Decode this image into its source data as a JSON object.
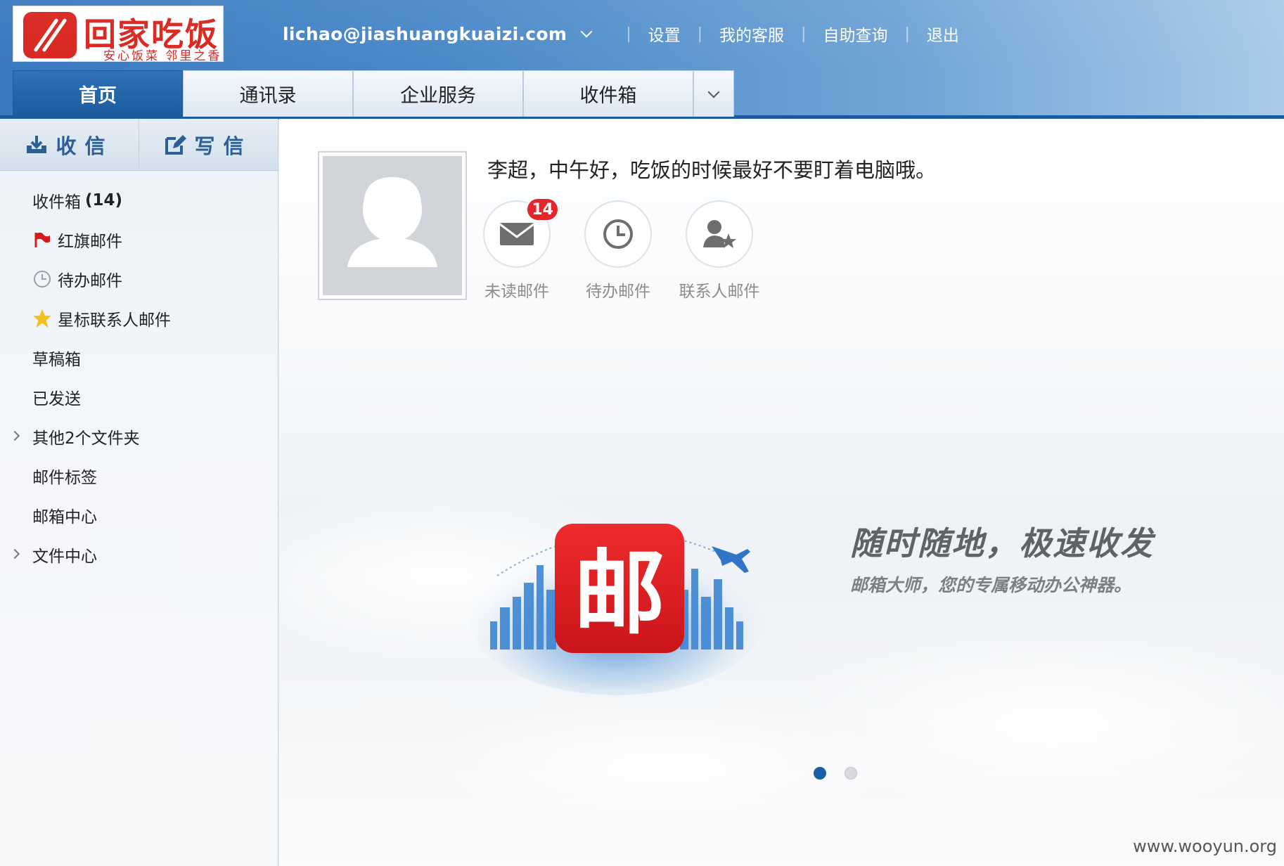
{
  "brand": {
    "logo_title": "回家吃饭",
    "logo_subtitle": "安心饭菜 邻里之香"
  },
  "topnav": {
    "email": "lichao@jiashuangkuaizi.com",
    "links": [
      "设置",
      "我的客服",
      "自助查询",
      "退出"
    ]
  },
  "tabs": [
    {
      "label": "首页",
      "active": true
    },
    {
      "label": "通讯录",
      "active": false
    },
    {
      "label": "企业服务",
      "active": false
    },
    {
      "label": "收件箱",
      "active": false
    }
  ],
  "sidebar": {
    "receive_label": "收信",
    "compose_label": "写信",
    "folders": [
      {
        "label": "收件箱",
        "count": "(14)"
      },
      {
        "label": "红旗邮件",
        "icon": "red-flag-icon"
      },
      {
        "label": "待办邮件",
        "icon": "clock-icon"
      },
      {
        "label": "星标联系人邮件",
        "icon": "star-icon"
      },
      {
        "label": "草稿箱"
      },
      {
        "label": "已发送"
      },
      {
        "label": "其他2个文件夹",
        "expandable": true
      },
      {
        "label": "邮件标签"
      },
      {
        "label": "邮箱中心"
      },
      {
        "label": "文件中心",
        "expandable": true
      }
    ]
  },
  "main": {
    "greeting": "李超，中午好，吃饭的时候最好不要盯着电脑哦。",
    "quick_links": [
      {
        "label": "未读邮件",
        "badge": "14",
        "icon": "envelope-icon"
      },
      {
        "label": "待办邮件",
        "icon": "clock-icon"
      },
      {
        "label": "联系人邮件",
        "icon": "contact-star-icon"
      }
    ],
    "promo": {
      "app_glyph": "邮",
      "title": "随时随地，极速收发",
      "subtitle": "邮箱大师，您的专属移动办公神器。"
    },
    "carousel": {
      "current": 1,
      "total": 2
    }
  },
  "watermark": "www.wooyun.org",
  "colors": {
    "header_blue": "#3a79be",
    "active_tab": "#1b5a9d",
    "brand_red": "#d8261f",
    "badge_red": "#e2262b"
  }
}
